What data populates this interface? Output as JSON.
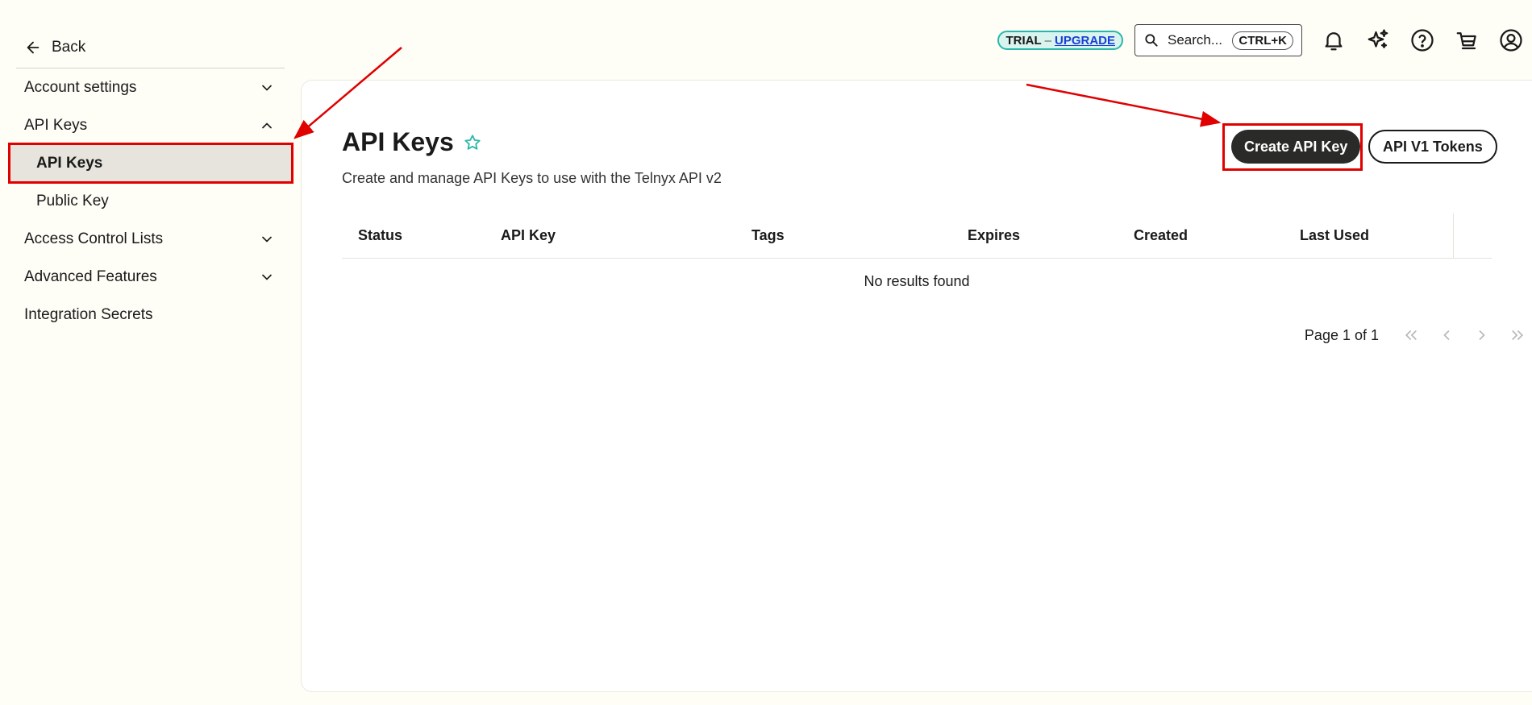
{
  "sidebar": {
    "back_label": "Back",
    "items": [
      {
        "label": "Account settings"
      },
      {
        "label": "API Keys"
      },
      {
        "label": "API Keys"
      },
      {
        "label": "Public Key"
      },
      {
        "label": "Access Control Lists"
      },
      {
        "label": "Advanced Features"
      },
      {
        "label": "Integration Secrets"
      }
    ]
  },
  "topbar": {
    "trial": "TRIAL",
    "separator": "–",
    "upgrade": "UPGRADE",
    "search_placeholder": "Search...",
    "search_shortcut": "CTRL+K"
  },
  "main": {
    "title": "API Keys",
    "subtitle": "Create and manage API Keys to use with the Telnyx API v2",
    "create_button": "Create API Key",
    "v1_button": "API V1 Tokens",
    "table": {
      "columns": [
        "Status",
        "API Key",
        "Tags",
        "Expires",
        "Created",
        "Last Used"
      ],
      "empty_message": "No results found"
    },
    "pagination": {
      "label": "Page 1 of 1"
    }
  },
  "colors": {
    "background": "#fefdf6",
    "accent_teal": "#2ab7a9",
    "annotation_red": "#e00000",
    "primary_button": "#2a2a28"
  }
}
